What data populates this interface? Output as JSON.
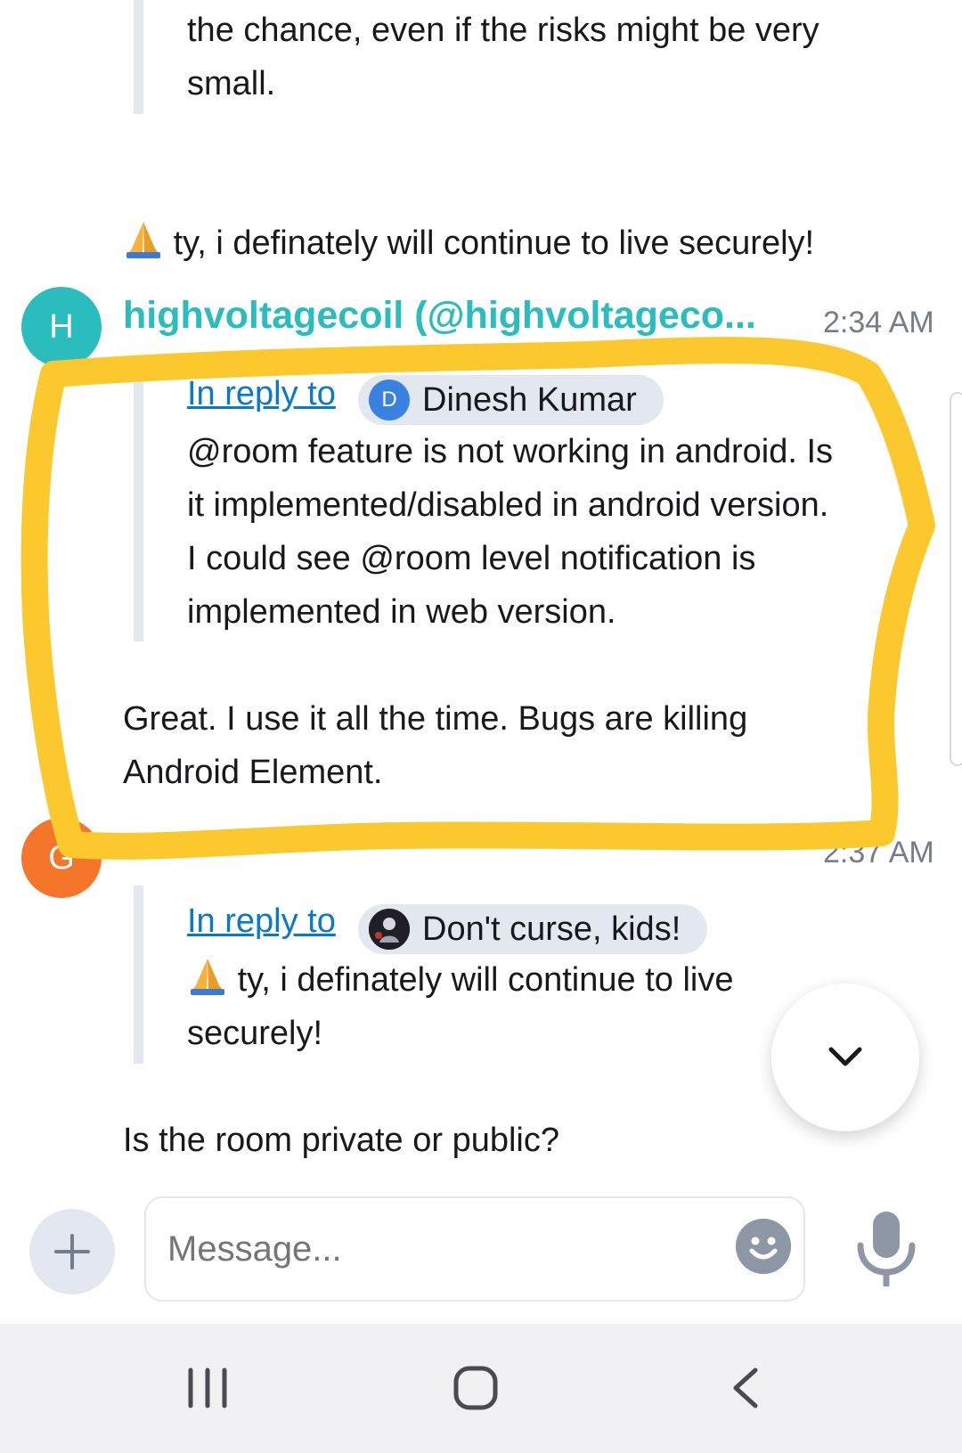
{
  "messages": [
    {
      "continuation": {
        "quote_lines": [
          "the chance, even if the risks might be very",
          "small."
        ]
      },
      "text": "ty, i definately will continue to live securely!",
      "emoji": "pray-emoji"
    },
    {
      "avatar_letter": "H",
      "avatar_color": "#2bbcbe",
      "sender": "highvoltagecoil (@highvoltageco...",
      "sender_color": "#2bbcbe",
      "time": "2:34 AM",
      "reply_link": "In reply to",
      "reply_user_initial": "D",
      "reply_user": "Dinesh Kumar",
      "quote_lines": [
        "@room feature is not working in android. Is",
        "it implemented/disabled in android version.",
        "I could see @room level notification is",
        "implemented in web version."
      ],
      "body_lines": [
        "Great. I use it all the time. Bugs are killing",
        "Android Element."
      ]
    },
    {
      "avatar_letter": "G",
      "avatar_color": "#f5752a",
      "time": "2:37 AM",
      "reply_link": "In reply to",
      "reply_user": "Don't curse, kids!",
      "quote_lines": [
        "ty, i definately will continue to live",
        "securely!"
      ],
      "body": "Is the room private or public?"
    }
  ],
  "composer": {
    "placeholder": "Message..."
  },
  "colors": {
    "highlight": "#fbc82d",
    "link": "#0a79c9",
    "pill": "#e3e8f0"
  },
  "icons": {
    "scroll_down": "chevron-down-icon",
    "add": "plus-icon",
    "emoji": "smiley-icon",
    "mic": "microphone-icon",
    "nav_recents": "recents-icon",
    "nav_home": "home-icon",
    "nav_back": "back-icon"
  }
}
